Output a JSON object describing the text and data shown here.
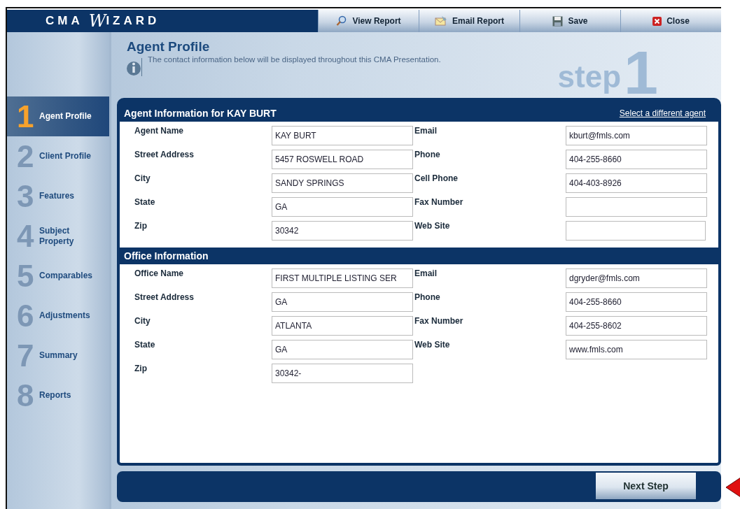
{
  "logo": {
    "prefix": "CMA",
    "initial": "W",
    "rest": "IZARD"
  },
  "toolbar": [
    {
      "label": "View Report",
      "kind": "view"
    },
    {
      "label": "Email Report",
      "kind": "email"
    },
    {
      "label": "Save",
      "kind": "save"
    },
    {
      "label": "Close",
      "kind": "close"
    }
  ],
  "page": {
    "title": "Agent Profile",
    "description": "The contact information below will be displayed throughout this CMA Presentation.",
    "step_word": "step",
    "step_number": "1"
  },
  "steps": [
    {
      "number": "1",
      "label": "Agent Profile",
      "selected": true
    },
    {
      "number": "2",
      "label": "Client Profile",
      "selected": false
    },
    {
      "number": "3",
      "label": "Features",
      "selected": false
    },
    {
      "number": "4",
      "label": "Subject Property",
      "selected": false
    },
    {
      "number": "5",
      "label": "Comparables",
      "selected": false
    },
    {
      "number": "6",
      "label": "Adjustments",
      "selected": false
    },
    {
      "number": "7",
      "label": "Summary",
      "selected": false
    },
    {
      "number": "8",
      "label": "Reports",
      "selected": false
    }
  ],
  "sections": [
    {
      "title": "Agent Information for KAY BURT",
      "link": "Select a different agent",
      "left": [
        {
          "label": "Agent Name",
          "value": "KAY BURT"
        },
        {
          "label": "Street Address",
          "value": "5457 ROSWELL ROAD"
        },
        {
          "label": "City",
          "value": "SANDY SPRINGS"
        },
        {
          "label": "State",
          "value": "GA"
        },
        {
          "label": "Zip",
          "value": "30342"
        }
      ],
      "right": [
        {
          "label": "Email",
          "value": "kburt@fmls.com"
        },
        {
          "label": "Phone",
          "value": "404-255-8660"
        },
        {
          "label": "Cell Phone",
          "value": "404-403-8926"
        },
        {
          "label": "Fax Number"
        },
        {
          "label": "Web Site"
        }
      ]
    },
    {
      "title": "Office Information",
      "left": [
        {
          "label": "Office Name",
          "value": "FIRST MULTIPLE LISTING SER"
        },
        {
          "label": "Street Address",
          "value": "GA"
        },
        {
          "label": "City",
          "value": "ATLANTA"
        },
        {
          "label": "State",
          "value": "GA"
        },
        {
          "label": "Zip",
          "value": "30342-"
        }
      ],
      "right": [
        {
          "label": "Email",
          "value": "dgryder@fmls.com"
        },
        {
          "label": "Phone",
          "value": "404-255-8660"
        },
        {
          "label": "Fax Number",
          "value": "404-255-8602"
        },
        {
          "label": "Web Site",
          "value": "www.fmls.com"
        }
      ]
    }
  ],
  "next_button": "Next Step"
}
